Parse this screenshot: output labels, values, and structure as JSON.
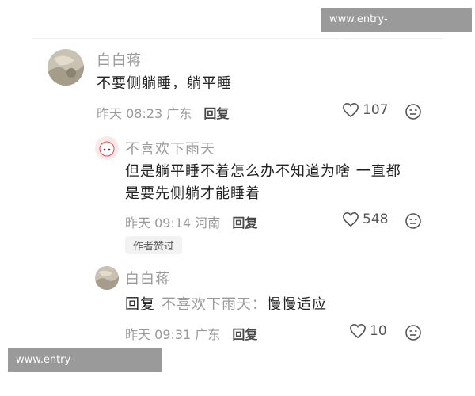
{
  "watermark_top": "www.entry-milansport.com",
  "watermark_bottom": "www.entry-milansport.com",
  "comments": [
    {
      "user": "白白蒋",
      "text": "不要侧躺睡，躺平睡",
      "time": "昨天 08:23",
      "location": "广东",
      "reply_label": "回复",
      "likes": "107"
    },
    {
      "user": "不喜欢下雨天",
      "text_line1": "但是躺平睡不着怎么办不知道为啥 一直都",
      "text_line2": "是要先侧躺才能睡着",
      "time": "昨天 09:14",
      "location": "河南",
      "reply_label": "回复",
      "likes": "548",
      "badge": "作者赞过"
    },
    {
      "user": "白白蒋",
      "reply_prefix": "回复",
      "reply_to": "不喜欢下雨天：",
      "text": "慢慢适应",
      "time": "昨天 09:31",
      "location": "广东",
      "reply_label": "回复",
      "likes": "10"
    }
  ],
  "colors": {
    "muted": "#9a9a9a",
    "text": "#222222",
    "watermark_bg": "#9a9a9a"
  },
  "icons": [
    "heart-outline-icon",
    "dislike-face-icon"
  ]
}
